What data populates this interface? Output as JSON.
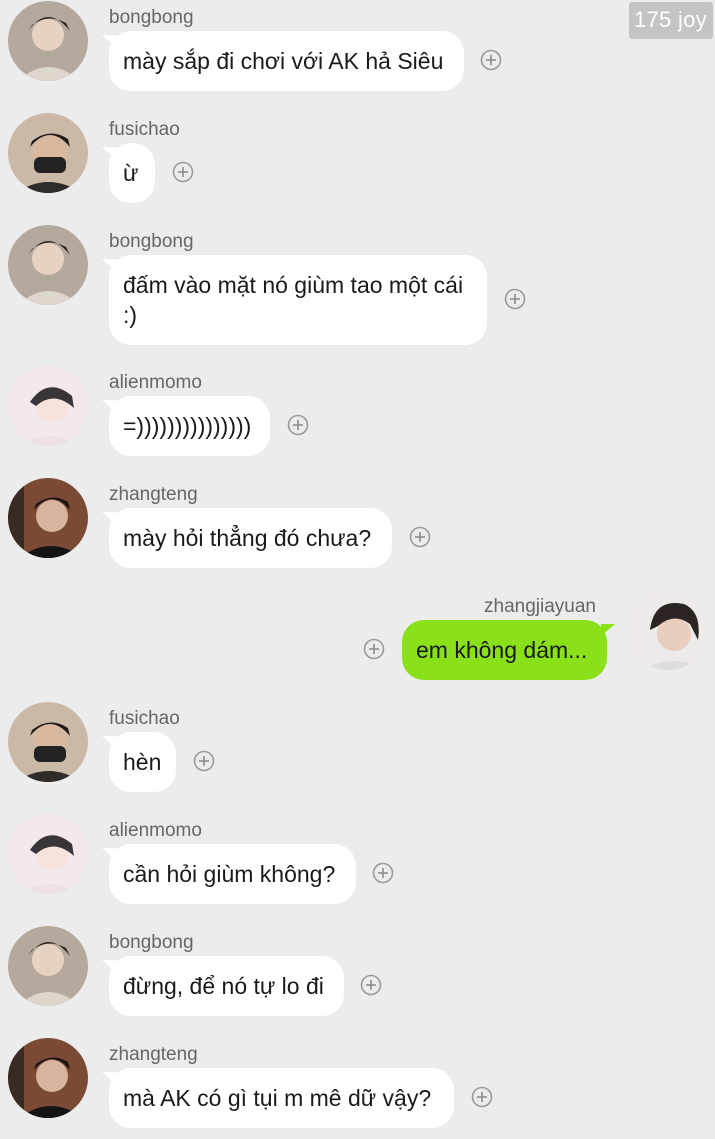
{
  "watermark": "175 joy",
  "colors": {
    "background": "#ececec",
    "incoming_bubble": "#ffffff",
    "outgoing_bubble": "#8ae11a"
  },
  "add_icon": "add-circle-icon",
  "messages": [
    {
      "sender": "bongbong",
      "text": "mày sắp đi chơi với AK hả Siêu",
      "direction": "in"
    },
    {
      "sender": "fusichao",
      "text": "ừ",
      "direction": "in"
    },
    {
      "sender": "bongbong",
      "text": "đấm vào mặt nó giùm tao một cái :)",
      "direction": "in"
    },
    {
      "sender": "alienmomo",
      "text": "=)))))))))))))))",
      "direction": "in"
    },
    {
      "sender": "zhangteng",
      "text": "mày hỏi thẳng đó chưa?",
      "direction": "in"
    },
    {
      "sender": "zhangjiayuan",
      "text": "em không dám...",
      "direction": "out"
    },
    {
      "sender": "fusichao",
      "text": "hèn",
      "direction": "in"
    },
    {
      "sender": "alienmomo",
      "text": "cần hỏi giùm không?",
      "direction": "in"
    },
    {
      "sender": "bongbong",
      "text": "đừng, để nó tự lo đi",
      "direction": "in"
    },
    {
      "sender": "zhangteng",
      "text": "mà AK có gì tụi m mê dữ vậy?",
      "direction": "in"
    }
  ]
}
